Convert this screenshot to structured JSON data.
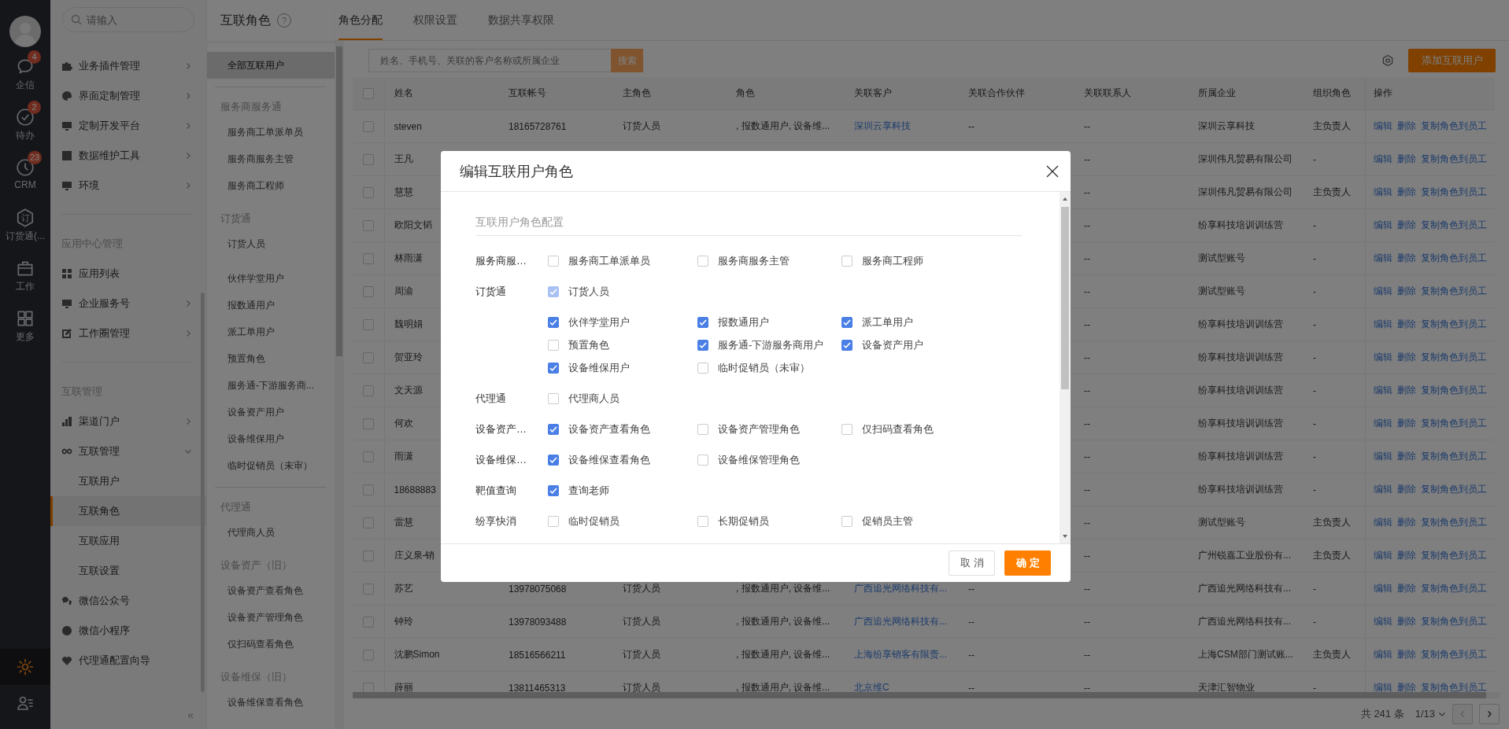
{
  "rail": {
    "items": [
      {
        "label": "企信",
        "badge": "4"
      },
      {
        "label": "待办",
        "badge": "2"
      },
      {
        "label": "CRM",
        "badge": "23"
      },
      {
        "label": "订货通(...",
        "icon_text": "订"
      },
      {
        "label": "工作"
      },
      {
        "label": "更多"
      }
    ],
    "bottom": [
      {
        "selected": true
      },
      {
        "selected": false
      }
    ]
  },
  "nav": {
    "search_placeholder": "请输入",
    "collapse": "«",
    "sections": [
      {
        "items": [
          {
            "label": "业务插件管理",
            "expanded": false
          },
          {
            "label": "界面定制管理",
            "expanded": false
          },
          {
            "label": "定制开发平台",
            "expanded": false
          },
          {
            "label": "数据维护工具",
            "expanded": false
          },
          {
            "label": "环境",
            "expanded": false
          }
        ]
      },
      {
        "heading": "应用中心管理",
        "items": [
          {
            "label": "应用列表"
          },
          {
            "label": "企业服务号",
            "expanded": false
          },
          {
            "label": "工作圈管理",
            "expanded": false
          }
        ]
      },
      {
        "heading": "互联管理",
        "items": [
          {
            "label": "渠道门户",
            "expanded": false
          },
          {
            "label": "互联管理",
            "expanded": true,
            "children": [
              {
                "label": "互联用户",
                "selected": false
              },
              {
                "label": "互联角色",
                "selected": true
              },
              {
                "label": "互联应用",
                "selected": false
              },
              {
                "label": "互联设置",
                "selected": false
              }
            ]
          },
          {
            "label": "微信公众号"
          },
          {
            "label": "微信小程序"
          },
          {
            "label": "代理通配置向导"
          }
        ]
      }
    ]
  },
  "roles_panel": {
    "title": "互联角色",
    "help": "?",
    "groups": [
      {
        "sets": [
          [
            {
              "label": "全部互联用户",
              "selected": true
            }
          ]
        ]
      },
      {
        "heading": "服务商服务通",
        "divider": true,
        "sets": [
          [
            {
              "label": "服务商工单派单员",
              "selected": false
            },
            {
              "label": "服务商服务主管",
              "selected": false
            },
            {
              "label": "服务商工程师",
              "selected": false
            }
          ]
        ]
      },
      {
        "heading": "订货通",
        "sets": [
          [
            {
              "label": "订货人员",
              "selected": false
            }
          ],
          [
            {
              "label": "伙伴学堂用户",
              "selected": false
            },
            {
              "label": "报数通用户",
              "selected": false
            },
            {
              "label": "派工单用户",
              "selected": false
            },
            {
              "label": "预置角色",
              "selected": false
            },
            {
              "label": "服务通-下游服务商...",
              "selected": false
            },
            {
              "label": "设备资产用户",
              "selected": false
            },
            {
              "label": "设备维保用户",
              "selected": false
            },
            {
              "label": "临时促销员（未审）",
              "selected": false
            }
          ]
        ]
      },
      {
        "heading": "代理通",
        "divider": true,
        "sets": [
          [
            {
              "label": "代理商人员",
              "selected": false
            }
          ]
        ]
      },
      {
        "heading": "设备资产（旧）",
        "sets": [
          [
            {
              "label": "设备资产查看角色",
              "selected": false
            },
            {
              "label": "设备资产管理角色",
              "selected": false
            },
            {
              "label": "仅扫码查看角色",
              "selected": false
            }
          ]
        ]
      },
      {
        "heading": "设备维保（旧）",
        "sets": [
          [
            {
              "label": "设备维保查看角色",
              "selected": false
            }
          ]
        ]
      }
    ]
  },
  "tabs": [
    {
      "label": "角色分配",
      "selected": true
    },
    {
      "label": "权限设置",
      "selected": false
    },
    {
      "label": "数据共享权限",
      "selected": false
    }
  ],
  "toolbar": {
    "search_placeholder": "姓名、手机号、关联的客户名称或所属企业",
    "search_button": "搜索",
    "add_button": "添加互联用户"
  },
  "table": {
    "select_all_checked": false,
    "columns": [
      "姓名",
      "互联帐号",
      "主角色",
      "角色",
      "关联客户",
      "关联合作伙伴",
      "关联联系人",
      "所属企业",
      "组织角色",
      "操作"
    ],
    "rows": [
      {
        "checked": false,
        "name": "steven",
        "account": "18165728761",
        "main_role": "订货人员",
        "roles": ", 报数通用户, 设备维...",
        "customer": "深圳云享科技",
        "partner": "--",
        "contact": "--",
        "company": "深圳云享科技",
        "org_role": "主负责人",
        "actions": [
          "编辑",
          "删除",
          "复制角色到员工"
        ]
      },
      {
        "checked": false,
        "name": "王凡",
        "contact": "--",
        "company": "深圳伟凡贸易有限公司",
        "org_role": "-",
        "actions": [
          "编辑",
          "删除",
          "复制角色到员工"
        ]
      },
      {
        "checked": false,
        "name": "慧慧",
        "contact": "--",
        "company": "深圳伟凡贸易有限公司",
        "org_role": "主负责人",
        "actions": [
          "编辑",
          "删除",
          "复制角色到员工"
        ]
      },
      {
        "checked": false,
        "name": "欧阳文韬",
        "contact": "--",
        "company": "纷享科技培训训练营",
        "org_role": "-",
        "actions": [
          "编辑",
          "删除",
          "复制角色到员工"
        ]
      },
      {
        "checked": false,
        "name": "林雨潇",
        "contact": "--",
        "company": "测试型账号",
        "org_role": "-",
        "actions": [
          "编辑",
          "删除",
          "复制角色到员工"
        ]
      },
      {
        "checked": false,
        "name": "周渝",
        "contact": "--",
        "company": "测试型账号",
        "org_role": "-",
        "actions": [
          "编辑",
          "删除",
          "复制角色到员工"
        ]
      },
      {
        "checked": false,
        "name": "魏明娟",
        "contact": "--",
        "company": "纷享科技培训训练营",
        "org_role": "-",
        "actions": [
          "编辑",
          "删除",
          "复制角色到员工"
        ]
      },
      {
        "checked": false,
        "name": "贺亚玲",
        "contact": "--",
        "company": "纷享科技培训训练营",
        "org_role": "-",
        "actions": [
          "编辑",
          "删除",
          "复制角色到员工"
        ]
      },
      {
        "checked": false,
        "name": "文天源",
        "contact": "--",
        "company": "纷享科技培训训练营",
        "org_role": "-",
        "actions": [
          "编辑",
          "删除",
          "复制角色到员工"
        ]
      },
      {
        "checked": false,
        "name": "何欢",
        "contact": "--",
        "company": "纷享科技培训训练营",
        "org_role": "-",
        "actions": [
          "编辑",
          "删除",
          "复制角色到员工"
        ]
      },
      {
        "checked": false,
        "name": "雨潇",
        "contact": "--",
        "company": "纷享科技培训训练营",
        "org_role": "-",
        "actions": [
          "编辑",
          "删除",
          "复制角色到员工"
        ]
      },
      {
        "checked": false,
        "name": "18688883",
        "contact": "--",
        "company": "纷享科技培训训练营",
        "org_role": "-",
        "actions": [
          "编辑",
          "删除",
          "复制角色到员工"
        ]
      },
      {
        "checked": false,
        "name": "雷慧",
        "contact": "--",
        "company": "测试型账号",
        "org_role": "主负责人",
        "actions": [
          "编辑",
          "删除",
          "复制角色到员工"
        ]
      },
      {
        "checked": false,
        "name": "庄义泉-销",
        "contact": "--",
        "company": "广州锐嘉工业股份有...",
        "org_role": "主负责人",
        "actions": [
          "编辑",
          "删除",
          "复制角色到员工"
        ]
      },
      {
        "checked": false,
        "name": "苏艺",
        "account": "13978075068",
        "main_role": "订货人员",
        "roles": ", 报数通用户, 设备维...",
        "customer": "广西追光网络科技有...",
        "partner": "--",
        "contact": "--",
        "company": "广西追光网络科技有...",
        "org_role": "-",
        "actions": [
          "编辑",
          "删除",
          "复制角色到员工"
        ]
      },
      {
        "checked": false,
        "name": "钟玲",
        "account": "13978093488",
        "main_role": "订货人员",
        "roles": ", 报数通用户, 设备维...",
        "customer": "广西追光网络科技有...",
        "partner": "--",
        "contact": "--",
        "company": "广西追光网络科技有...",
        "org_role": "-",
        "actions": [
          "编辑",
          "删除",
          "复制角色到员工"
        ]
      },
      {
        "checked": false,
        "name": "沈鹏Simon",
        "account": "18516566211",
        "main_role": "订货人员",
        "roles": ", 报数通用户, 设备维...",
        "customer": "上海纷享销客有限责...",
        "partner": "--",
        "contact": "--",
        "company": "上海CSM部门测试账...",
        "org_role": "主负责人",
        "actions": [
          "编辑",
          "删除",
          "复制角色到员工"
        ]
      },
      {
        "checked": false,
        "name": "薛丽",
        "account": "13811465313",
        "main_role": "订货人员",
        "roles": ", 报数通用户, 设备维...",
        "customer": "北京维C",
        "partner": "--",
        "contact": "--",
        "company": "天津汇智物业",
        "org_role": "-",
        "actions": [
          "编辑",
          "删除",
          "复制角色到员工"
        ]
      }
    ]
  },
  "pagination": {
    "total": "共 241 条",
    "page": "1/13",
    "prev": {
      "disabled": true
    },
    "next": {
      "disabled": false
    }
  },
  "modal": {
    "title": "编辑互联用户角色",
    "section": "互联用户角色配置",
    "rows": [
      {
        "label": "服务商服…",
        "groups": [
          [
            {
              "label": "服务商工单派单员",
              "checked": false
            },
            {
              "label": "服务商服务主管",
              "checked": false
            },
            {
              "label": "服务商工程师",
              "checked": false
            }
          ]
        ]
      },
      {
        "label": "订货通",
        "groups": [
          [
            {
              "label": "订货人员",
              "checked": true,
              "disabled": true
            }
          ],
          [
            {
              "label": "伙伴学堂用户",
              "checked": true
            },
            {
              "label": "报数通用户",
              "checked": true
            },
            {
              "label": "派工单用户",
              "checked": true
            },
            {
              "label": "预置角色",
              "checked": false
            },
            {
              "label": "服务通-下游服务商用户",
              "checked": true
            },
            {
              "label": "设备资产用户",
              "checked": true
            },
            {
              "label": "设备维保用户",
              "checked": true
            },
            {
              "label": "临时促销员（未审）",
              "checked": false
            }
          ]
        ]
      },
      {
        "label": "代理通",
        "groups": [
          [
            {
              "label": "代理商人员",
              "checked": false
            }
          ]
        ]
      },
      {
        "label": "设备资产…",
        "groups": [
          [
            {
              "label": "设备资产查看角色",
              "checked": true
            },
            {
              "label": "设备资产管理角色",
              "checked": false
            },
            {
              "label": "仅扫码查看角色",
              "checked": false
            }
          ]
        ]
      },
      {
        "label": "设备维保…",
        "groups": [
          [
            {
              "label": "设备维保查看角色",
              "checked": true
            },
            {
              "label": "设备维保管理角色",
              "checked": false
            }
          ]
        ]
      },
      {
        "label": "靶值查询",
        "groups": [
          [
            {
              "label": "查询老师",
              "checked": true
            }
          ]
        ]
      },
      {
        "label": "纷享快消",
        "groups": [
          [
            {
              "label": "临时促销员",
              "checked": false
            },
            {
              "label": "长期促销员",
              "checked": false
            },
            {
              "label": "促销员主管",
              "checked": false
            }
          ]
        ]
      }
    ],
    "buttons": [
      {
        "label": "取消",
        "kind": "secondary"
      },
      {
        "label": "确定",
        "kind": "primary"
      }
    ]
  }
}
